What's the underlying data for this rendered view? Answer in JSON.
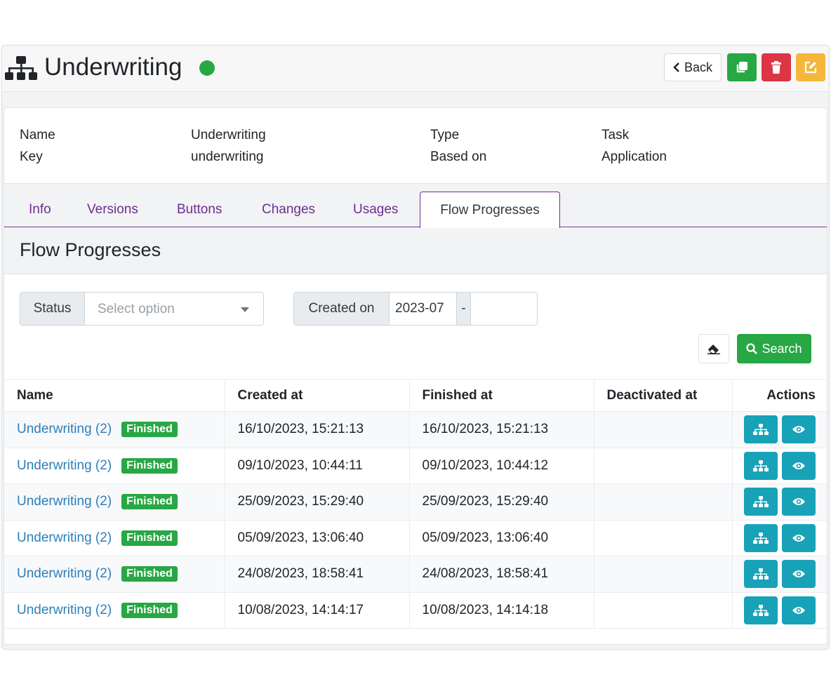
{
  "header": {
    "title": "Underwriting",
    "status_color": "#28a745",
    "back_label": "Back"
  },
  "info": {
    "name_label": "Name",
    "name_value": "Underwriting",
    "key_label": "Key",
    "key_value": "underwriting",
    "type_label": "Type",
    "type_value": "Task",
    "based_on_label": "Based on",
    "based_on_value": "Application"
  },
  "tabs": [
    {
      "label": "Info"
    },
    {
      "label": "Versions"
    },
    {
      "label": "Buttons"
    },
    {
      "label": "Changes"
    },
    {
      "label": "Usages"
    },
    {
      "label": "Flow Progresses",
      "active": true
    }
  ],
  "section": {
    "title": "Flow Progresses"
  },
  "filters": {
    "status_label": "Status",
    "status_placeholder": "Select option",
    "created_on_label": "Created on",
    "created_from": "2023-07",
    "range_separator": "-",
    "created_to": "",
    "search_label": "Search"
  },
  "table": {
    "columns": [
      "Name",
      "Created at",
      "Finished at",
      "Deactivated at",
      "Actions"
    ],
    "rows": [
      {
        "name": "Underwriting (2)",
        "badge": "Finished",
        "created": "16/10/2023, 15:21:13",
        "finished": "16/10/2023, 15:21:13",
        "deactivated": ""
      },
      {
        "name": "Underwriting (2)",
        "badge": "Finished",
        "created": "09/10/2023, 10:44:11",
        "finished": "09/10/2023, 10:44:12",
        "deactivated": ""
      },
      {
        "name": "Underwriting (2)",
        "badge": "Finished",
        "created": "25/09/2023, 15:29:40",
        "finished": "25/09/2023, 15:29:40",
        "deactivated": ""
      },
      {
        "name": "Underwriting (2)",
        "badge": "Finished",
        "created": "05/09/2023, 13:06:40",
        "finished": "05/09/2023, 13:06:40",
        "deactivated": ""
      },
      {
        "name": "Underwriting (2)",
        "badge": "Finished",
        "created": "24/08/2023, 18:58:41",
        "finished": "24/08/2023, 18:58:41",
        "deactivated": ""
      },
      {
        "name": "Underwriting (2)",
        "badge": "Finished",
        "created": "10/08/2023, 14:14:17",
        "finished": "10/08/2023, 14:14:18",
        "deactivated": ""
      }
    ]
  },
  "colors": {
    "accent_purple": "#6f2d91",
    "link_blue": "#2d7fb8",
    "success_green": "#28a745",
    "danger_red": "#dc3545",
    "warning_orange": "#f5b73b",
    "info_teal": "#17a2b8"
  },
  "icons": {
    "header": "sitemap-icon",
    "back": "chevron-left-icon",
    "copy": "copy-icon",
    "delete": "trash-icon",
    "edit": "edit-icon",
    "clear": "eraser-icon",
    "search": "search-icon",
    "row_flow": "sitemap-icon",
    "row_view": "eye-icon"
  }
}
